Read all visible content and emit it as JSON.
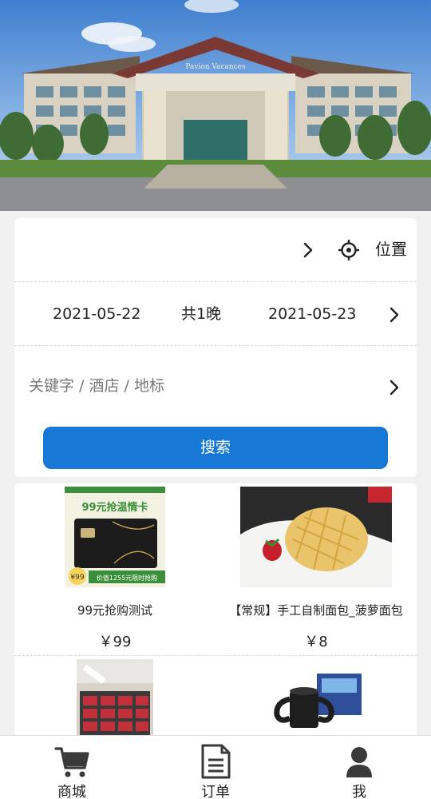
{
  "banner": {
    "image": "hotel-exterior-photo",
    "hotel_sign_text": "Pavion Vacances"
  },
  "search": {
    "location_label": "位置",
    "checkin_date": "2021-05-22",
    "nights": "共1晚",
    "checkout_date": "2021-05-23",
    "keyword_placeholder": "关键字 / 酒店 / 地标",
    "search_button": "搜索",
    "accent_color": "#1878d6"
  },
  "products": [
    {
      "name": "99元抢购测试",
      "price": "￥99",
      "image": "gift-card-promo",
      "image_text": [
        "99元抢温情卡",
        "价值1255元限时抢购"
      ]
    },
    {
      "name": "【常规】手工自制面包_菠萝面包",
      "price": "￥8",
      "image": "pineapple-bun-photo"
    },
    {
      "name": "",
      "price": "",
      "image": "buffet-meat-photo"
    },
    {
      "name": "",
      "price": "",
      "image": "gamepad-mug-photo"
    }
  ],
  "bottom_nav": [
    {
      "label": "商城",
      "icon": "cart-icon"
    },
    {
      "label": "订单",
      "icon": "document-icon"
    },
    {
      "label": "我",
      "icon": "user-icon"
    }
  ]
}
